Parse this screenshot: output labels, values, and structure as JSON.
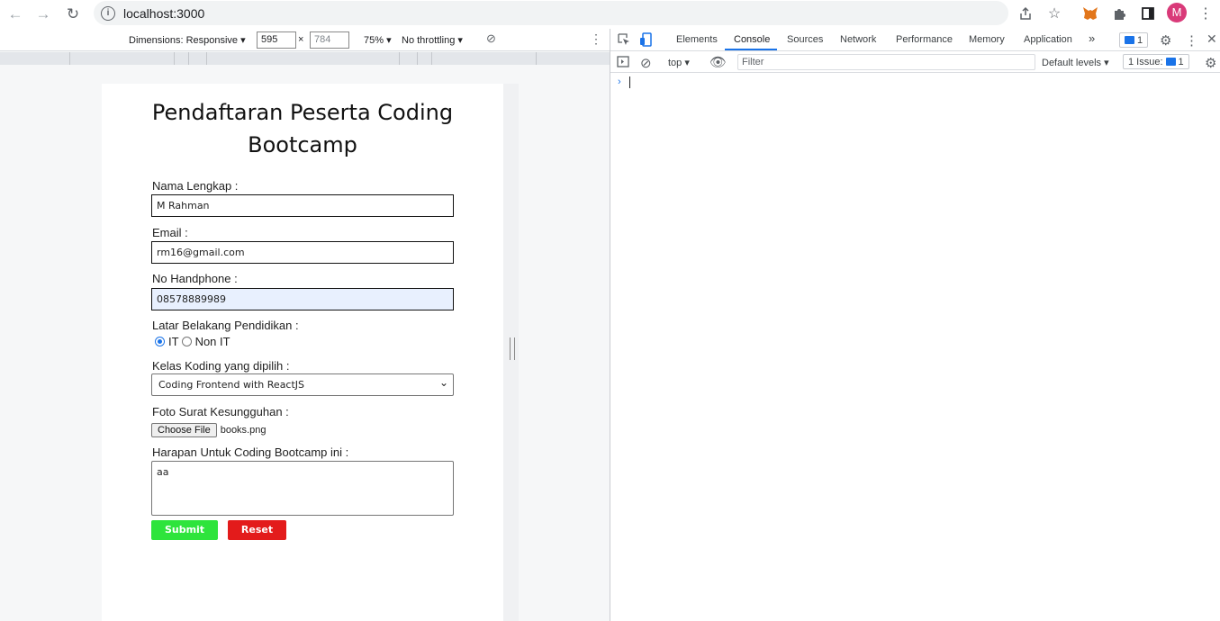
{
  "browser": {
    "url": "localhost:3000",
    "avatar_letter": "M",
    "icons": [
      "back-icon",
      "forward-icon",
      "reload-icon",
      "info-icon",
      "share-icon",
      "star-icon",
      "metamask-icon",
      "extensions-icon",
      "sidepanel-icon",
      "menu-icon"
    ]
  },
  "device_toolbar": {
    "dimensions_label": "Dimensions: Responsive",
    "width": "595",
    "height": "784",
    "times": "×",
    "zoom": "75%",
    "throttling": "No throttling"
  },
  "form": {
    "title": "Pendaftaran Peserta Coding Bootcamp",
    "name_label": "Nama Lengkap :",
    "name_value": "M Rahman",
    "email_label": "Email :",
    "email_value": "rm16@gmail.com",
    "phone_label": "No Handphone :",
    "phone_value": "08578889989",
    "education_label": "Latar Belakang Pendidikan :",
    "education_options": [
      {
        "label": "IT",
        "checked": true
      },
      {
        "label": "Non IT",
        "checked": false
      }
    ],
    "class_label": "Kelas Koding yang dipilih :",
    "class_selected": "Coding Frontend with ReactJS",
    "photo_label": "Foto Surat Kesungguhan :",
    "file_button": "Choose File",
    "file_name": "books.png",
    "hope_label": "Harapan Untuk Coding Bootcamp ini :",
    "hope_value": "aa",
    "submit_label": "Submit",
    "reset_label": "Reset",
    "submit_color": "#2ee43c",
    "reset_color": "#e31b1b"
  },
  "devtools": {
    "tabs": [
      "Elements",
      "Console",
      "Sources",
      "Network",
      "Performance",
      "Memory",
      "Application"
    ],
    "active_tab": "Console",
    "more": "»",
    "issues_badge": "1",
    "context": "top",
    "filter_placeholder": "Filter",
    "levels": "Default levels",
    "issue_count": "1 Issue:",
    "issue_badge_count": "1",
    "prompt": "›"
  }
}
